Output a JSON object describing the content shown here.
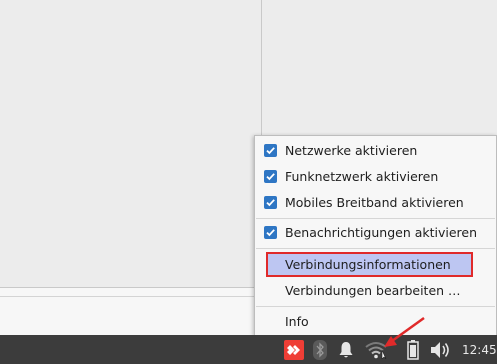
{
  "menu": {
    "items": [
      {
        "label": "Netzwerke aktivieren",
        "checked": true
      },
      {
        "label": "Funknetzwerk aktivieren",
        "checked": true
      },
      {
        "label": "Mobiles Breitband aktivieren",
        "checked": true
      },
      {
        "label": "Benachrichtigungen aktivieren",
        "checked": true
      },
      {
        "label": "Verbindungsinformationen",
        "checked": false,
        "highlighted": true
      },
      {
        "label": "Verbindungen bearbeiten …",
        "checked": false
      },
      {
        "label": "Info",
        "checked": false
      }
    ]
  },
  "tray": {
    "icons": [
      "anydesk-icon",
      "bluetooth-icon",
      "notification-bell-icon",
      "wifi-icon",
      "battery-icon",
      "volume-icon"
    ],
    "clock": "12:45"
  },
  "colors": {
    "checkbox": "#2e76c4",
    "highlight_bg": "#bdc6f2",
    "annotation_red": "#e02a2a",
    "taskbar": "#3c3c3c"
  }
}
